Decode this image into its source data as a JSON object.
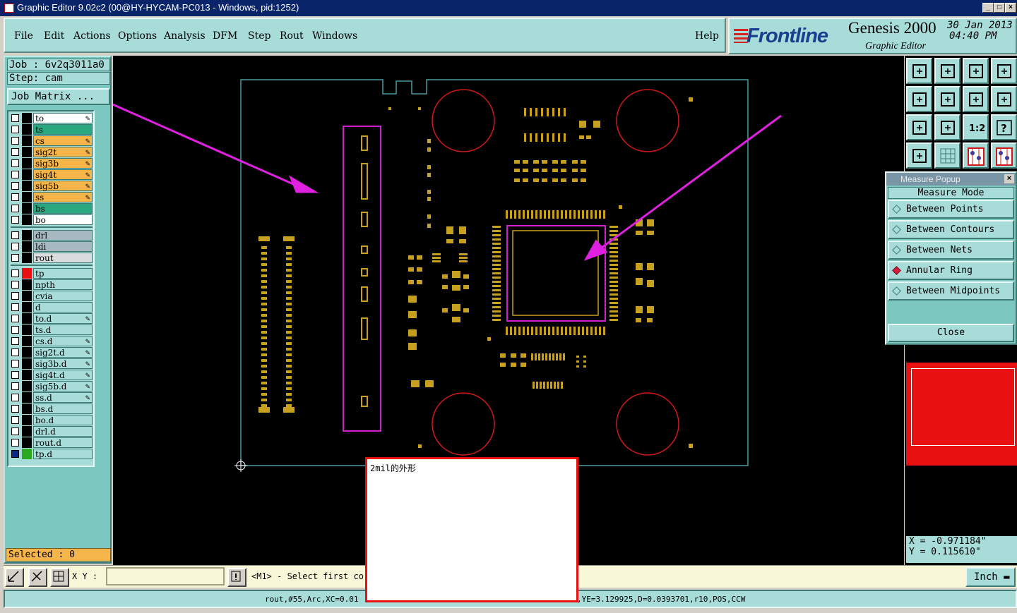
{
  "window": {
    "title": "Graphic Editor 9.02c2 (00@HY-HYCAM-PC013 - Windows, pid:1252)",
    "minimize": "_",
    "maximize": "□",
    "close": "×"
  },
  "menu": {
    "file": "File",
    "edit": "Edit",
    "actions": "Actions",
    "options": "Options",
    "analysis": "Analysis",
    "dfm": "DFM",
    "step": "Step",
    "rout": "Rout",
    "windows": "Windows",
    "help": "Help"
  },
  "logo": {
    "brand": "Frontline",
    "product": "Genesis 2000",
    "subtitle": "Graphic Editor",
    "date": "30 Jan 2013",
    "time": "04:40 PM"
  },
  "job": {
    "job_line": "Job : 6v2q3011a0",
    "step_line": "Step: cam",
    "matrix_label": "Job Matrix ..."
  },
  "layers": {
    "group1": [
      {
        "name": "to",
        "color": "#ffffff",
        "pen": true
      },
      {
        "name": "ts",
        "color": "#2aa880",
        "pen": false
      },
      {
        "name": "cs",
        "color": "#f5b54a",
        "pen": true
      },
      {
        "name": "sig2t",
        "color": "#f5b54a",
        "pen": true
      },
      {
        "name": "sig3b",
        "color": "#f5b54a",
        "pen": true
      },
      {
        "name": "sig4t",
        "color": "#f5b54a",
        "pen": true
      },
      {
        "name": "sig5b",
        "color": "#f5b54a",
        "pen": true
      },
      {
        "name": "ss",
        "color": "#f5b54a",
        "pen": true
      },
      {
        "name": "bs",
        "color": "#2aa880",
        "pen": false
      },
      {
        "name": "bo",
        "color": "#ffffff",
        "pen": false
      }
    ],
    "group2": [
      {
        "name": "drl",
        "color": "#a8b8c0",
        "pen": false
      },
      {
        "name": "ldi",
        "color": "#a8b8c0",
        "pen": false
      },
      {
        "name": "rout",
        "color": "#d8dcdc",
        "pen": false
      }
    ],
    "group3": [
      {
        "name": "tp",
        "color": "#a8dcd8",
        "pen": false
      },
      {
        "name": "npth",
        "color": "#a8dcd8",
        "pen": false
      },
      {
        "name": "cvia",
        "color": "#a8dcd8",
        "pen": false
      },
      {
        "name": "d",
        "color": "#a8dcd8",
        "pen": false
      },
      {
        "name": "to.d",
        "color": "#a8dcd8",
        "pen": true
      },
      {
        "name": "ts.d",
        "color": "#a8dcd8",
        "pen": false
      },
      {
        "name": "cs.d",
        "color": "#a8dcd8",
        "pen": true
      },
      {
        "name": "sig2t.d",
        "color": "#a8dcd8",
        "pen": true
      },
      {
        "name": "sig3b.d",
        "color": "#a8dcd8",
        "pen": true
      },
      {
        "name": "sig4t.d",
        "color": "#a8dcd8",
        "pen": true
      },
      {
        "name": "sig5b.d",
        "color": "#a8dcd8",
        "pen": true
      },
      {
        "name": "ss.d",
        "color": "#a8dcd8",
        "pen": true
      },
      {
        "name": "bs.d",
        "color": "#a8dcd8",
        "pen": false
      },
      {
        "name": "bo.d",
        "color": "#a8dcd8",
        "pen": false
      },
      {
        "name": "drl.d",
        "color": "#a8dcd8",
        "pen": false
      },
      {
        "name": "rout.d",
        "color": "#a8dcd8",
        "pen": false
      },
      {
        "name": "tp.d",
        "color": "#a8dcd8",
        "pen": false
      }
    ],
    "pen_glyph": "✎"
  },
  "selected": "Selected : 0",
  "measure_popup": {
    "title": "Measure Popup",
    "mode_label": "Measure Mode",
    "options": [
      "Between Points",
      "Between Contours",
      "Between Nets",
      "Annular Ring",
      "Between Midpoints"
    ],
    "active_option": "Annular Ring",
    "close_label": "Close",
    "close_glyph": "×"
  },
  "toolbox_icons": [
    "zoom-home-icon",
    "zoom-out-icon",
    "home-icon",
    "window-icon",
    "pan-left-icon",
    "pan-right-icon",
    "undo-icon",
    "snap-icon",
    "fit-icon",
    "zoom-center-icon",
    "scale-1to2-icon",
    "help-icon",
    "tools-icon",
    "grid-icon",
    "layers-red-icon",
    "layers-blue-icon"
  ],
  "toolbox_labels": {
    "scale": "1:2",
    "help": "?"
  },
  "coords": {
    "x": "X = -0.971184\"",
    "y": "Y = 0.115610\""
  },
  "command": {
    "xy_label": "X Y :",
    "xy_value": "",
    "prompt": "<M1> - Select first cor",
    "unit": "Inch"
  },
  "status": {
    "left": "rout,#55,Arc,XC=0.01",
    "right": ",YE=3.129925,D=0.0393701,r10,POS,CCW"
  },
  "note": "2mil的外形",
  "colors": {
    "board_outline": "#4a9aa0",
    "pads": "#c8a020",
    "highlight": "#d020d0",
    "arrow": "#e020e0",
    "circle": "#d01818",
    "overview_bg": "#e81010"
  }
}
